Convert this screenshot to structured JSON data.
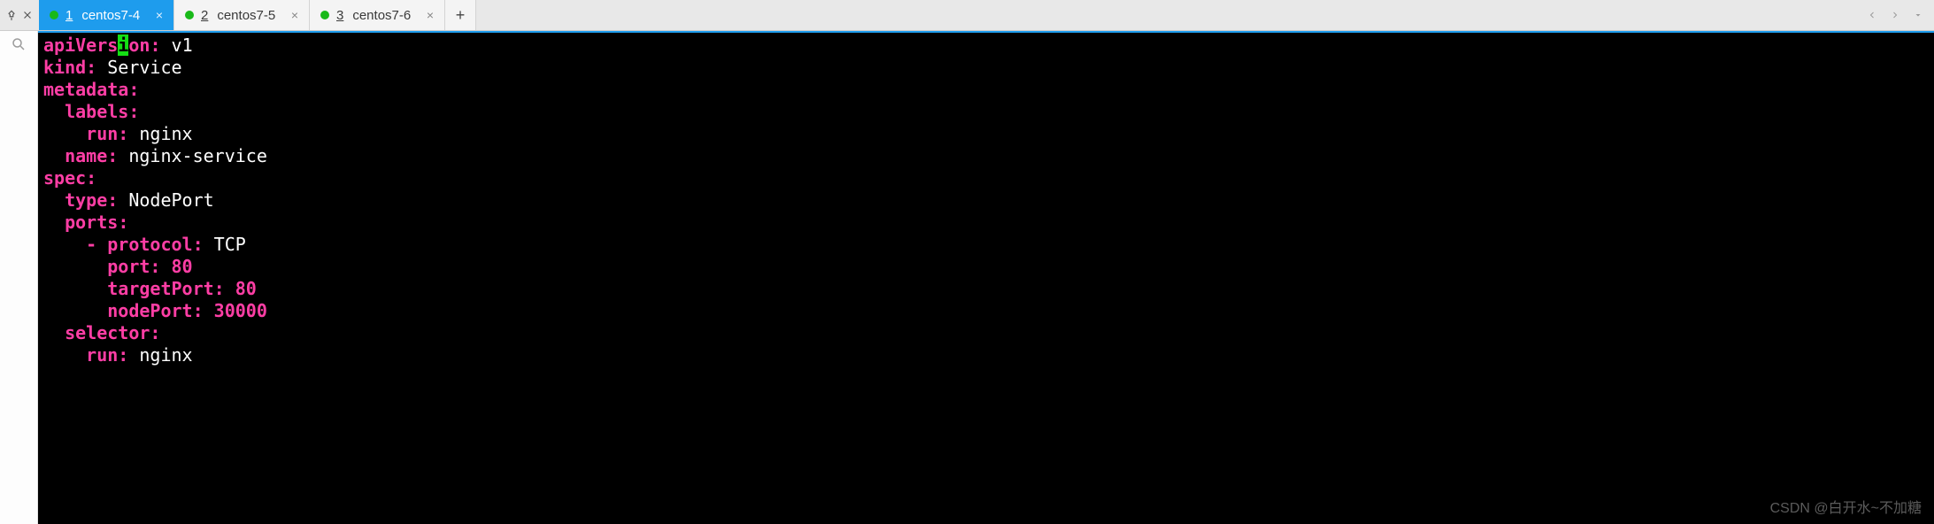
{
  "toolbar": {
    "tabs": [
      {
        "num": "1",
        "name": "centos7-4",
        "active": true
      },
      {
        "num": "2",
        "name": "centos7-5",
        "active": false
      },
      {
        "num": "3",
        "name": "centos7-6",
        "active": false
      }
    ],
    "newtab_label": "+",
    "close_glyph": "×"
  },
  "yaml": {
    "l1_key": "apiVers",
    "l1_cursor": "i",
    "l1_key2": "on",
    "l1_colon": ":",
    "l1_val": " v1",
    "l2_key": "kind",
    "l2_colon": ":",
    "l2_val": " Service",
    "l3_key": "metadata",
    "l3_colon": ":",
    "l4_indent": "  ",
    "l4_key": "labels",
    "l4_colon": ":",
    "l5_indent": "    ",
    "l5_key": "run",
    "l5_colon": ":",
    "l5_val": " nginx",
    "l6_indent": "  ",
    "l6_key": "name",
    "l6_colon": ":",
    "l6_val": " nginx-service",
    "l7_key": "spec",
    "l7_colon": ":",
    "l8_indent": "  ",
    "l8_key": "type",
    "l8_colon": ":",
    "l8_val": " NodePort",
    "l9_indent": "  ",
    "l9_key": "ports",
    "l9_colon": ":",
    "l10_indent": "    ",
    "l10_dash": "- ",
    "l10_key": "protocol",
    "l10_colon": ":",
    "l10_val": " TCP",
    "l11_indent": "      ",
    "l11_key": "port",
    "l11_colon": ":",
    "l11_val": " 80",
    "l12_indent": "      ",
    "l12_key": "targetPort",
    "l12_colon": ":",
    "l12_val": " 80",
    "l13_indent": "      ",
    "l13_key": "nodePort",
    "l13_colon": ":",
    "l13_val": " 30000",
    "l14_indent": "  ",
    "l14_key": "selector",
    "l14_colon": ":",
    "l15_indent": "    ",
    "l15_key": "run",
    "l15_colon": ":",
    "l15_val": " nginx"
  },
  "watermark": "CSDN @白开水~不加糖"
}
